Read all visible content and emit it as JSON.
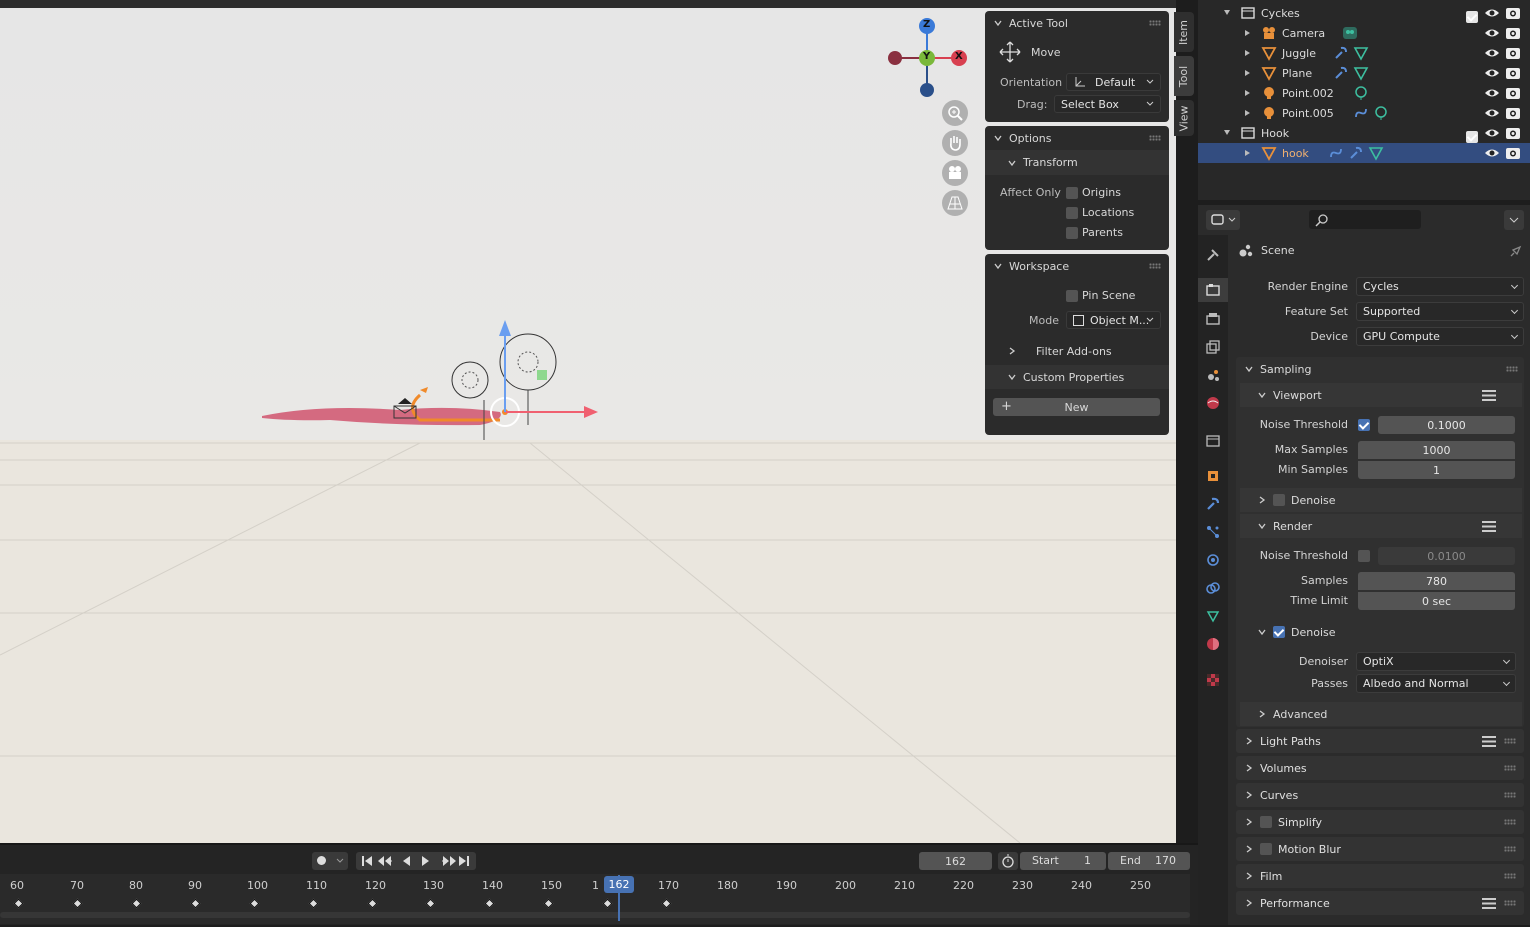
{
  "viewport": {
    "gizmo": {
      "z": "Z",
      "y": "Y",
      "x": "X"
    },
    "sidebar_tabs": [
      "Item",
      "Tool",
      "View"
    ],
    "active_tool": {
      "title": "Active Tool",
      "tool_name": "Move",
      "orientation_label": "Orientation",
      "orientation_value": "Default",
      "drag_label": "Drag:",
      "drag_value": "Select Box"
    },
    "options": {
      "title": "Options",
      "transform": "Transform",
      "affect_only": "Affect Only",
      "origins": "Origins",
      "locations": "Locations",
      "parents": "Parents"
    },
    "workspace": {
      "title": "Workspace",
      "pin_scene": "Pin Scene",
      "mode_label": "Mode",
      "mode_value": "Object M...",
      "filter_addons": "Filter Add-ons",
      "custom_properties": "Custom Properties",
      "new_button": "New"
    }
  },
  "timeline": {
    "current_frame": "162",
    "start_label": "Start",
    "start_value": "1",
    "end_label": "End",
    "end_value": "170",
    "ruler_ticks": [
      "60",
      "70",
      "80",
      "90",
      "100",
      "110",
      "120",
      "130",
      "140",
      "150",
      "1",
      "170",
      "180",
      "190",
      "200",
      "210",
      "220",
      "230",
      "240",
      "250"
    ],
    "playhead": "162"
  },
  "outliner": {
    "rows": [
      {
        "name": "Cyckes",
        "kind": "collection"
      },
      {
        "name": "Camera",
        "kind": "camera"
      },
      {
        "name": "Juggle",
        "kind": "mesh"
      },
      {
        "name": "Plane",
        "kind": "mesh"
      },
      {
        "name": "Point.002",
        "kind": "light"
      },
      {
        "name": "Point.005",
        "kind": "light"
      },
      {
        "name": "Hook",
        "kind": "collection"
      },
      {
        "name": "hook",
        "kind": "mesh"
      }
    ]
  },
  "properties": {
    "scene_label": "Scene",
    "render_engine_label": "Render Engine",
    "render_engine": "Cycles",
    "feature_set_label": "Feature Set",
    "feature_set": "Supported",
    "device_label": "Device",
    "device": "GPU Compute",
    "sampling": "Sampling",
    "viewport": "Viewport",
    "noise_threshold_label": "Noise Threshold",
    "viewport_noise_threshold": "0.1000",
    "max_samples_label": "Max Samples",
    "max_samples": "1000",
    "min_samples_label": "Min Samples",
    "min_samples": "1",
    "denoise": "Denoise",
    "render": "Render",
    "render_noise_threshold": "0.0100",
    "samples_label": "Samples",
    "samples": "780",
    "time_limit_label": "Time Limit",
    "time_limit": "0 sec",
    "denoiser_label": "Denoiser",
    "denoiser": "OptiX",
    "passes_label": "Passes",
    "passes": "Albedo and Normal",
    "advanced": "Advanced",
    "sections": [
      "Light Paths",
      "Volumes",
      "Curves",
      "Simplify",
      "Motion Blur",
      "Film",
      "Performance"
    ]
  },
  "colors": {
    "accent": "#4772b3",
    "orange": "#e8903a",
    "teal": "#3dbfa0"
  }
}
